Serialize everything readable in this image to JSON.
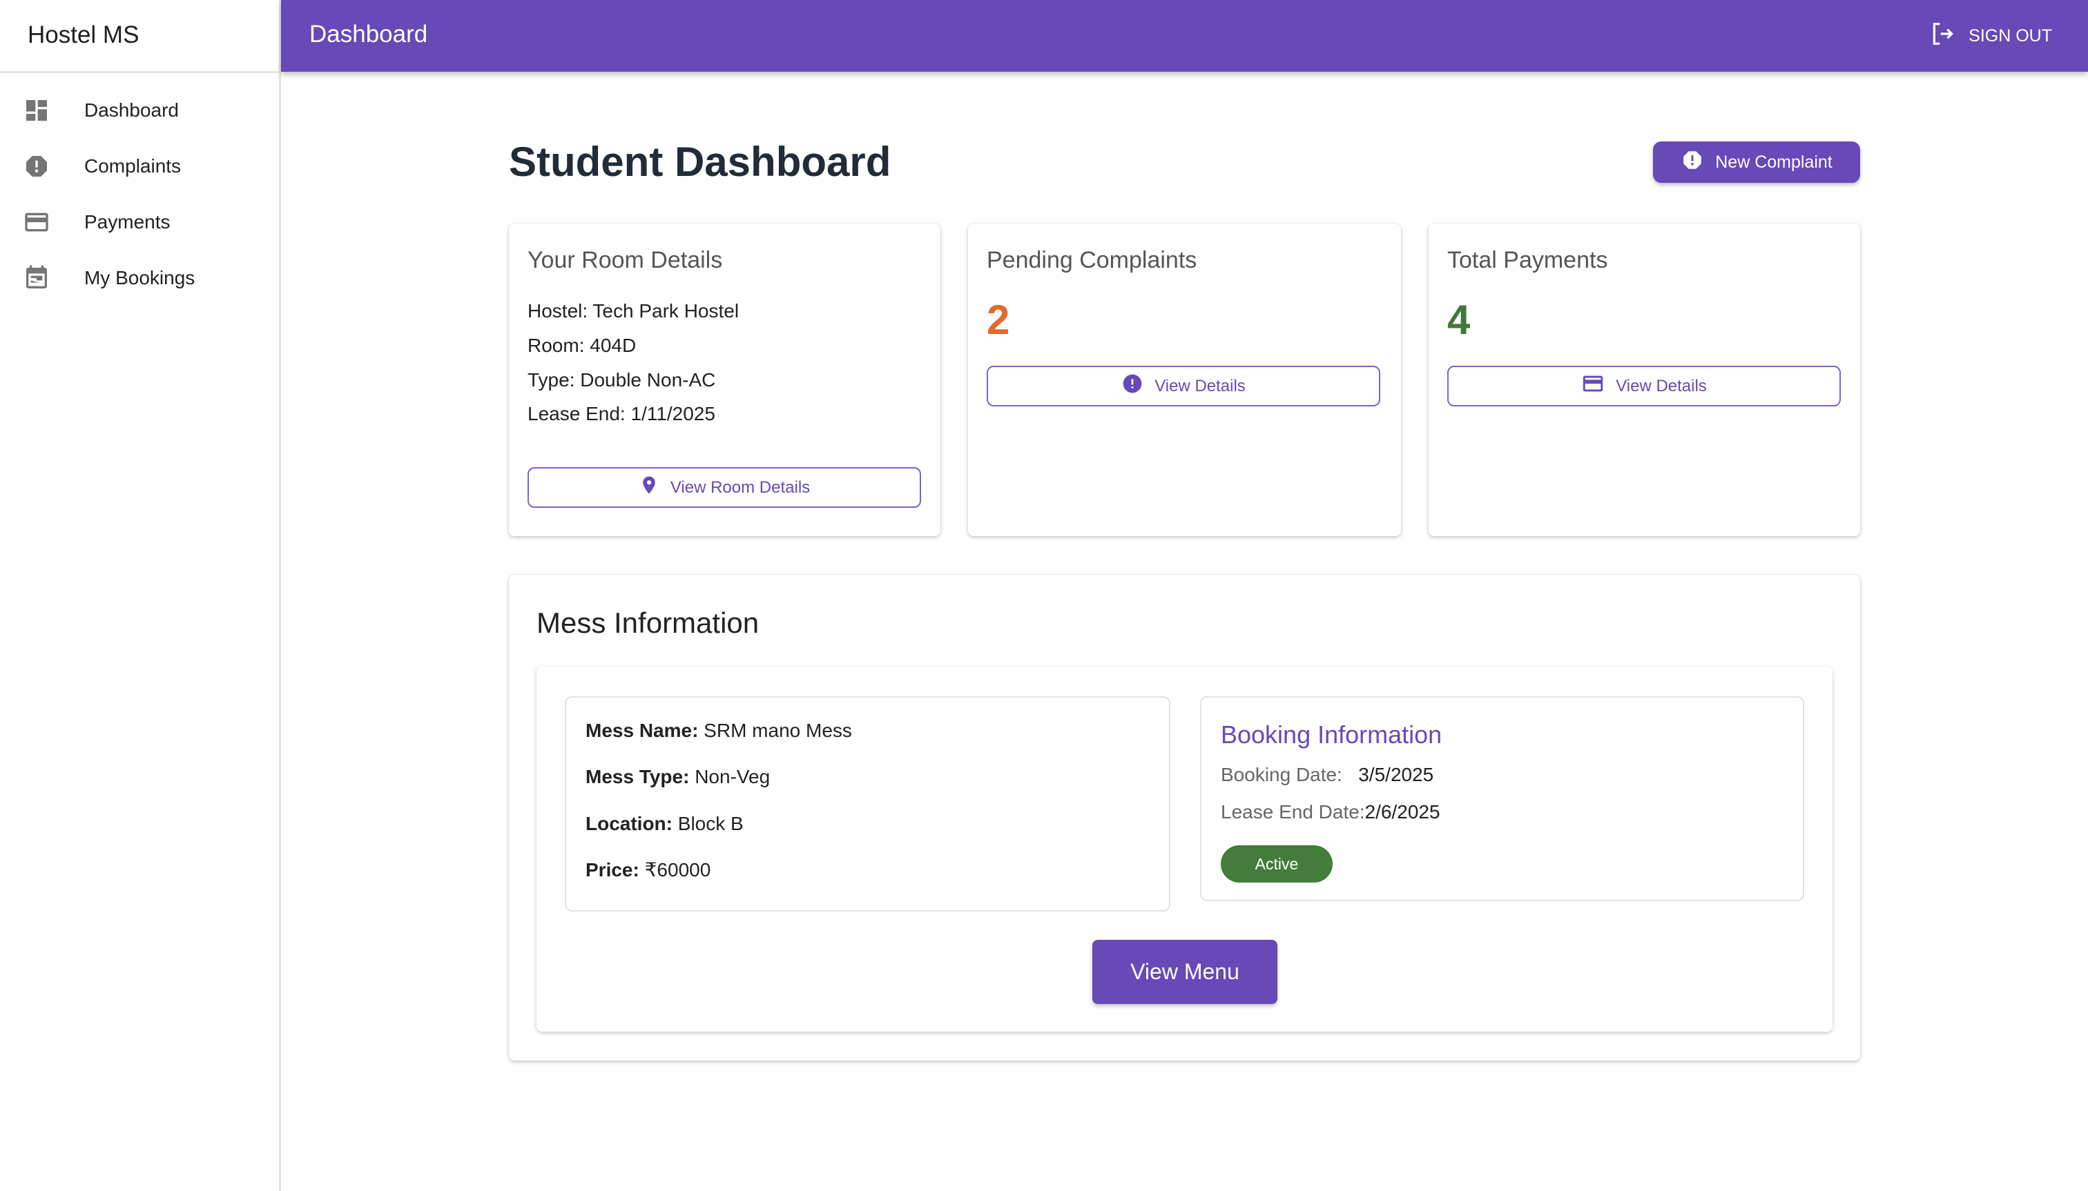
{
  "sidebar": {
    "logo": "Hostel MS",
    "items": [
      {
        "label": "Dashboard",
        "icon": "dashboard-icon"
      },
      {
        "label": "Complaints",
        "icon": "alert-octagon-icon"
      },
      {
        "label": "Payments",
        "icon": "credit-card-icon"
      },
      {
        "label": "My Bookings",
        "icon": "calendar-icon"
      }
    ]
  },
  "appbar": {
    "title": "Dashboard",
    "sign_out": "SIGN OUT"
  },
  "main": {
    "title": "Student Dashboard",
    "new_complaint": "New Complaint",
    "room_card": {
      "title": "Your Room Details",
      "lines": [
        "Hostel: Tech Park Hostel",
        "Room: 404D",
        "Type: Double Non-AC",
        "Lease End: 1/11/2025"
      ],
      "button": "View Room Details"
    },
    "complaints_card": {
      "title": "Pending Complaints",
      "count": "2",
      "button": "View Details"
    },
    "payments_card": {
      "title": "Total Payments",
      "count": "4",
      "button": "View Details"
    },
    "mess": {
      "title": "Mess Information",
      "details": [
        {
          "label": "Mess Name:",
          "value": " SRM mano Mess"
        },
        {
          "label": "Mess Type:",
          "value": " Non-Veg"
        },
        {
          "label": "Location:",
          "value": " Block B"
        },
        {
          "label": "Price:",
          "value": " ₹60000"
        }
      ],
      "booking": {
        "title": "Booking Information",
        "booking_date_label": "Booking Date:",
        "booking_date": "3/5/2025",
        "lease_end_label": "Lease End Date:",
        "lease_end": "2/6/2025",
        "status": "Active"
      },
      "view_menu": "View Menu"
    }
  },
  "colors": {
    "primary": "#6749b8",
    "orange": "#e4692a",
    "green": "#3d7a3a",
    "chip": "#437c3b"
  }
}
